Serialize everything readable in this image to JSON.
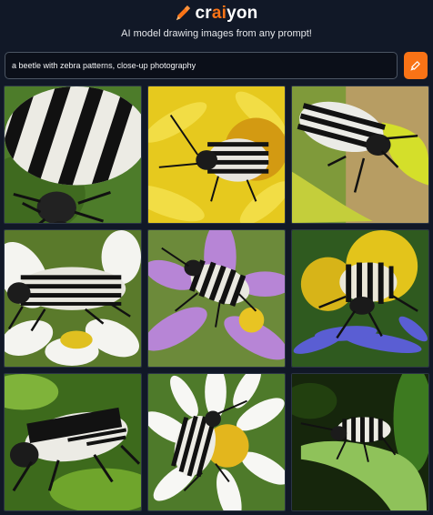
{
  "header": {
    "logo_prefix": "cr",
    "logo_accent": "ai",
    "logo_suffix": "yon",
    "logo_icon": "pencil-icon",
    "tagline": "AI model drawing images from any prompt!"
  },
  "prompt": {
    "value": "a beetle with zebra patterns, close-up photography",
    "button_icon": "pencil-icon"
  },
  "colors": {
    "background": "#111827",
    "accent": "#f97316"
  },
  "results": [
    {
      "label": "result image 1"
    },
    {
      "label": "result image 2"
    },
    {
      "label": "result image 3"
    },
    {
      "label": "result image 4"
    },
    {
      "label": "result image 5"
    },
    {
      "label": "result image 6"
    },
    {
      "label": "result image 7"
    },
    {
      "label": "result image 8"
    },
    {
      "label": "result image 9"
    }
  ]
}
